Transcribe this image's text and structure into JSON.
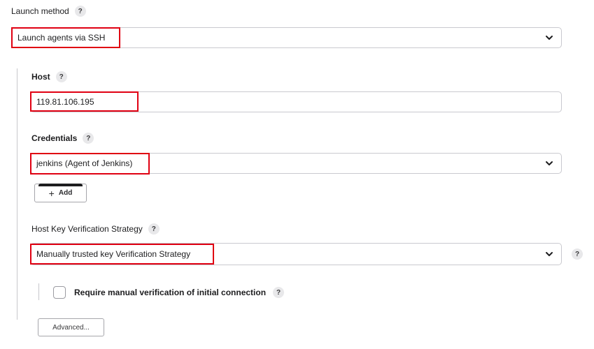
{
  "launch_method": {
    "label": "Launch method",
    "help": "?",
    "selected": "Launch agents via SSH"
  },
  "host": {
    "label": "Host",
    "help": "?",
    "value": "119.81.106.195"
  },
  "credentials": {
    "label": "Credentials",
    "help": "?",
    "selected": "jenkins (Agent of Jenkins)",
    "add_plus": "+",
    "add_label": "Add"
  },
  "host_key": {
    "label": "Host Key Verification Strategy",
    "help": "?",
    "selected": "Manually trusted key Verification Strategy",
    "side_help": "?"
  },
  "manual_verification": {
    "label": "Require manual verification of initial connection",
    "help": "?",
    "checked": false
  },
  "advanced_button": {
    "label": "Advanced..."
  },
  "colors": {
    "highlight": "#e00012",
    "border": "#c9c9cf",
    "help_bg": "#e8e8ea"
  }
}
